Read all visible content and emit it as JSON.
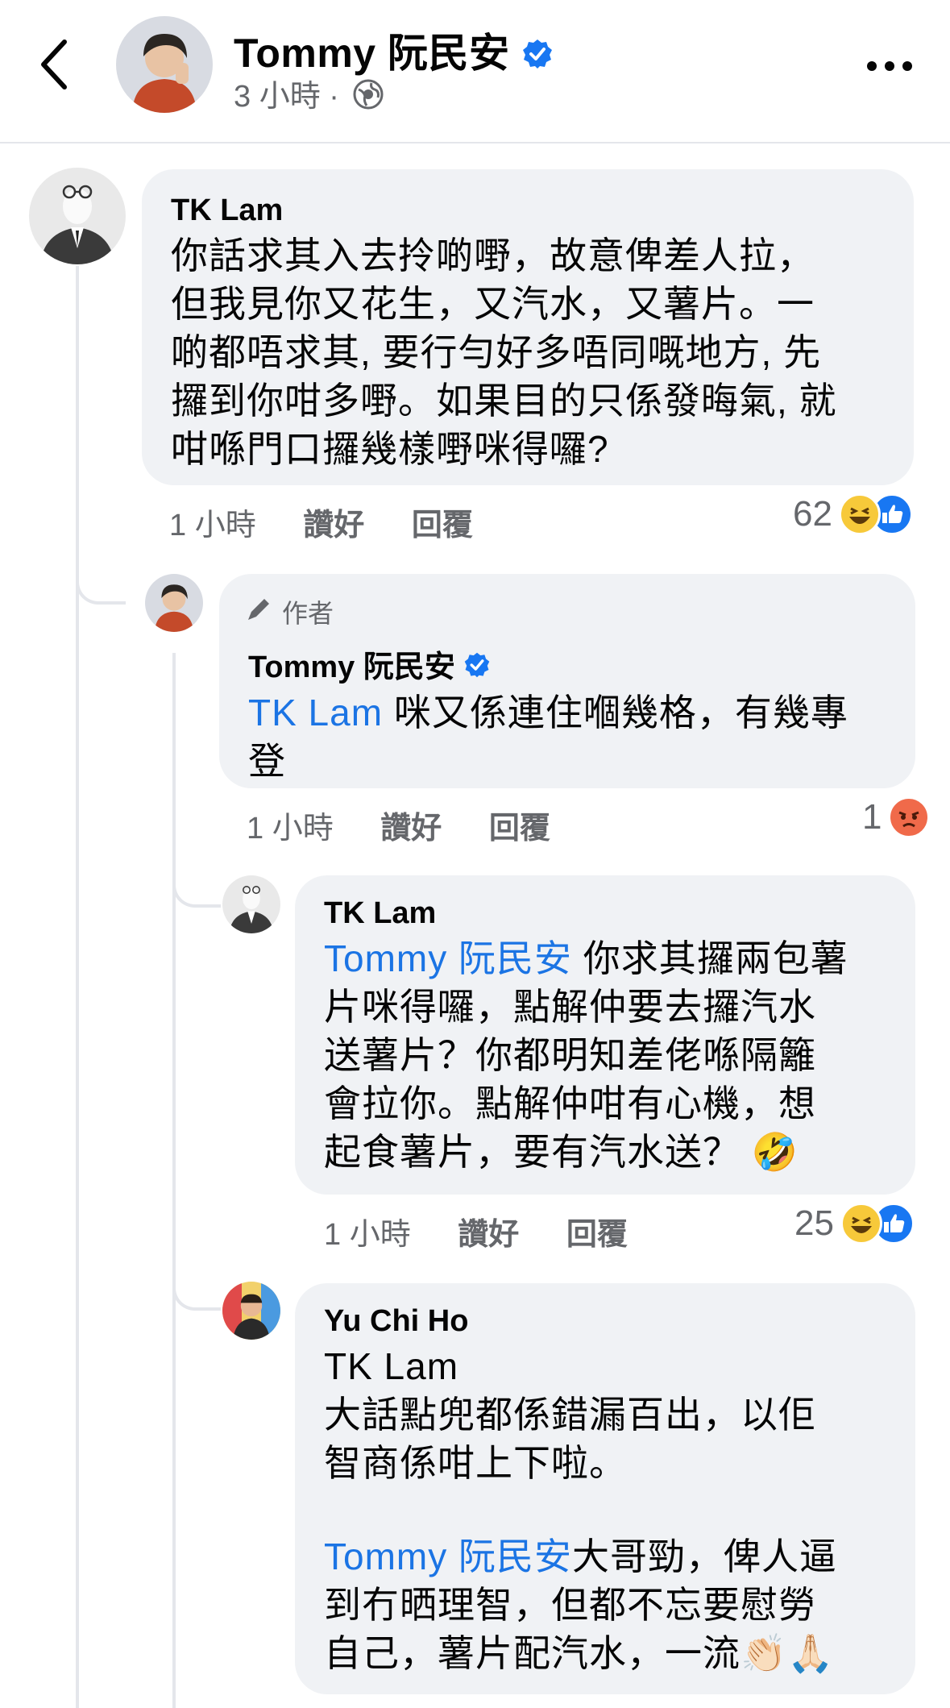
{
  "header": {
    "title": "Tommy 阮民安",
    "time": "3 小時 ·"
  },
  "comments": [
    {
      "name": "TK Lam",
      "text_lines": [
        "你話求其入去拎啲嘢，故意俾差人拉，",
        "但我見你又花生，又汽水，又薯片。一",
        "啲都唔求其, 要行勻好多唔同嘅地方, 先",
        "攞到你咁多嘢。如果目的只係發晦氣, 就",
        "咁喺門口攞幾樣嘢咪得囉?"
      ],
      "time": "1 小時",
      "like": "讚好",
      "reply": "回覆",
      "reaction_count": "62"
    },
    {
      "author_badge": "作者",
      "name": "Tommy 阮民安",
      "mention": "TK Lam",
      "text_first": " 咪又係連住嗰幾格，有幾專",
      "text_second": "登",
      "time": "1 小時",
      "like": "讚好",
      "reply": "回覆",
      "reaction_count": "1"
    },
    {
      "name": "TK Lam",
      "mention": "Tommy 阮民安",
      "text_first": " 你求其攞兩包薯",
      "text_lines": [
        "片咪得囉，點解仲要去攞汽水",
        "送薯片？你都明知差佬喺隔籬",
        "會拉你。點解仲咁有心機，想",
        "起食薯片，要有汽水送？ 🤣"
      ],
      "time": "1 小時",
      "like": "讚好",
      "reply": "回覆",
      "reaction_count": "25"
    },
    {
      "name": "Yu Chi Ho",
      "text_lines": [
        "TK Lam",
        "大話點兜都係錯漏百出，以佢",
        "智商係咁上下啦。"
      ],
      "mention": "Tommy 阮民安",
      "text_after_mention": "大哥勁，俾人逼",
      "text_lines_2": [
        "到冇晒理智，但都不忘要慰勞",
        "自己，薯片配汽水，一流👏🏻🙏🏻"
      ]
    }
  ],
  "colors": {
    "bubble": "#f0f2f5",
    "mention": "#1b74e4",
    "verified": "#1877f2",
    "meta": "#65676b"
  }
}
